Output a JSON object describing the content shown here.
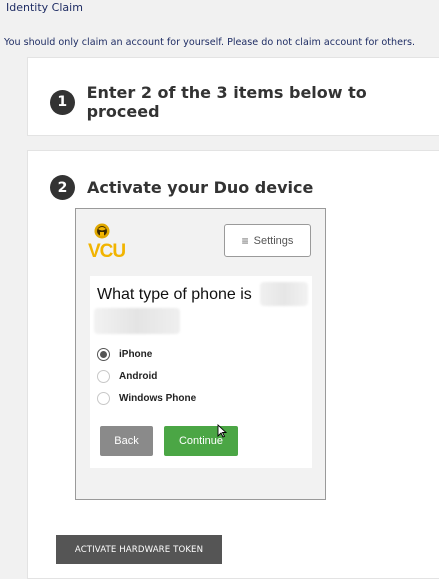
{
  "header": {
    "title": "Identity Claim",
    "note": "You should only claim an account for yourself. Please do not claim account for others."
  },
  "step1": {
    "number": "1",
    "text": "Enter 2 of the 3 items below to proceed"
  },
  "step2": {
    "number": "2",
    "text": "Activate your Duo device"
  },
  "duo": {
    "logo": "VCU",
    "settings_label": "Settings",
    "question": "What type of phone is",
    "options": [
      {
        "label": "iPhone",
        "selected": true
      },
      {
        "label": "Android",
        "selected": false
      },
      {
        "label": "Windows Phone",
        "selected": false
      }
    ],
    "back_label": "Back",
    "continue_label": "Continue"
  },
  "hardware_button": "ACTIVATE HARDWARE TOKEN",
  "colors": {
    "accent_green": "#4ba645",
    "vcu_gold": "#f2b400",
    "header_text": "#1f2d64"
  }
}
